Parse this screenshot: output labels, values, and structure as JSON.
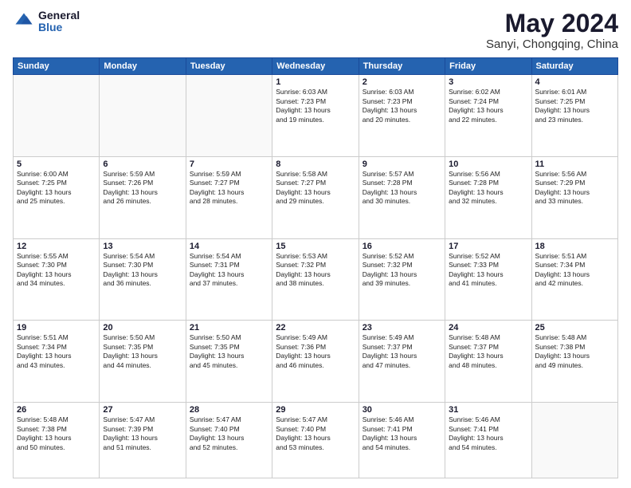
{
  "logo": {
    "general": "General",
    "blue": "Blue"
  },
  "title": "May 2024",
  "subtitle": "Sanyi, Chongqing, China",
  "days_of_week": [
    "Sunday",
    "Monday",
    "Tuesday",
    "Wednesday",
    "Thursday",
    "Friday",
    "Saturday"
  ],
  "weeks": [
    [
      {
        "day": "",
        "info": ""
      },
      {
        "day": "",
        "info": ""
      },
      {
        "day": "",
        "info": ""
      },
      {
        "day": "1",
        "info": "Sunrise: 6:03 AM\nSunset: 7:23 PM\nDaylight: 13 hours\nand 19 minutes."
      },
      {
        "day": "2",
        "info": "Sunrise: 6:03 AM\nSunset: 7:23 PM\nDaylight: 13 hours\nand 20 minutes."
      },
      {
        "day": "3",
        "info": "Sunrise: 6:02 AM\nSunset: 7:24 PM\nDaylight: 13 hours\nand 22 minutes."
      },
      {
        "day": "4",
        "info": "Sunrise: 6:01 AM\nSunset: 7:25 PM\nDaylight: 13 hours\nand 23 minutes."
      }
    ],
    [
      {
        "day": "5",
        "info": "Sunrise: 6:00 AM\nSunset: 7:25 PM\nDaylight: 13 hours\nand 25 minutes."
      },
      {
        "day": "6",
        "info": "Sunrise: 5:59 AM\nSunset: 7:26 PM\nDaylight: 13 hours\nand 26 minutes."
      },
      {
        "day": "7",
        "info": "Sunrise: 5:59 AM\nSunset: 7:27 PM\nDaylight: 13 hours\nand 28 minutes."
      },
      {
        "day": "8",
        "info": "Sunrise: 5:58 AM\nSunset: 7:27 PM\nDaylight: 13 hours\nand 29 minutes."
      },
      {
        "day": "9",
        "info": "Sunrise: 5:57 AM\nSunset: 7:28 PM\nDaylight: 13 hours\nand 30 minutes."
      },
      {
        "day": "10",
        "info": "Sunrise: 5:56 AM\nSunset: 7:28 PM\nDaylight: 13 hours\nand 32 minutes."
      },
      {
        "day": "11",
        "info": "Sunrise: 5:56 AM\nSunset: 7:29 PM\nDaylight: 13 hours\nand 33 minutes."
      }
    ],
    [
      {
        "day": "12",
        "info": "Sunrise: 5:55 AM\nSunset: 7:30 PM\nDaylight: 13 hours\nand 34 minutes."
      },
      {
        "day": "13",
        "info": "Sunrise: 5:54 AM\nSunset: 7:30 PM\nDaylight: 13 hours\nand 36 minutes."
      },
      {
        "day": "14",
        "info": "Sunrise: 5:54 AM\nSunset: 7:31 PM\nDaylight: 13 hours\nand 37 minutes."
      },
      {
        "day": "15",
        "info": "Sunrise: 5:53 AM\nSunset: 7:32 PM\nDaylight: 13 hours\nand 38 minutes."
      },
      {
        "day": "16",
        "info": "Sunrise: 5:52 AM\nSunset: 7:32 PM\nDaylight: 13 hours\nand 39 minutes."
      },
      {
        "day": "17",
        "info": "Sunrise: 5:52 AM\nSunset: 7:33 PM\nDaylight: 13 hours\nand 41 minutes."
      },
      {
        "day": "18",
        "info": "Sunrise: 5:51 AM\nSunset: 7:34 PM\nDaylight: 13 hours\nand 42 minutes."
      }
    ],
    [
      {
        "day": "19",
        "info": "Sunrise: 5:51 AM\nSunset: 7:34 PM\nDaylight: 13 hours\nand 43 minutes."
      },
      {
        "day": "20",
        "info": "Sunrise: 5:50 AM\nSunset: 7:35 PM\nDaylight: 13 hours\nand 44 minutes."
      },
      {
        "day": "21",
        "info": "Sunrise: 5:50 AM\nSunset: 7:35 PM\nDaylight: 13 hours\nand 45 minutes."
      },
      {
        "day": "22",
        "info": "Sunrise: 5:49 AM\nSunset: 7:36 PM\nDaylight: 13 hours\nand 46 minutes."
      },
      {
        "day": "23",
        "info": "Sunrise: 5:49 AM\nSunset: 7:37 PM\nDaylight: 13 hours\nand 47 minutes."
      },
      {
        "day": "24",
        "info": "Sunrise: 5:48 AM\nSunset: 7:37 PM\nDaylight: 13 hours\nand 48 minutes."
      },
      {
        "day": "25",
        "info": "Sunrise: 5:48 AM\nSunset: 7:38 PM\nDaylight: 13 hours\nand 49 minutes."
      }
    ],
    [
      {
        "day": "26",
        "info": "Sunrise: 5:48 AM\nSunset: 7:38 PM\nDaylight: 13 hours\nand 50 minutes."
      },
      {
        "day": "27",
        "info": "Sunrise: 5:47 AM\nSunset: 7:39 PM\nDaylight: 13 hours\nand 51 minutes."
      },
      {
        "day": "28",
        "info": "Sunrise: 5:47 AM\nSunset: 7:40 PM\nDaylight: 13 hours\nand 52 minutes."
      },
      {
        "day": "29",
        "info": "Sunrise: 5:47 AM\nSunset: 7:40 PM\nDaylight: 13 hours\nand 53 minutes."
      },
      {
        "day": "30",
        "info": "Sunrise: 5:46 AM\nSunset: 7:41 PM\nDaylight: 13 hours\nand 54 minutes."
      },
      {
        "day": "31",
        "info": "Sunrise: 5:46 AM\nSunset: 7:41 PM\nDaylight: 13 hours\nand 54 minutes."
      },
      {
        "day": "",
        "info": ""
      }
    ]
  ]
}
